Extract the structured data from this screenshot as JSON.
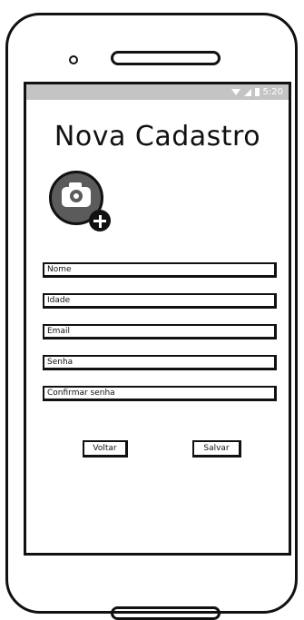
{
  "status_bar": {
    "time": "5:20"
  },
  "screen": {
    "title": "Nova Cadastro"
  },
  "form": {
    "fields": [
      {
        "placeholder": "Nome"
      },
      {
        "placeholder": "Idade"
      },
      {
        "placeholder": "Email"
      },
      {
        "placeholder": "Senha"
      },
      {
        "placeholder": "Confirmar senha"
      }
    ]
  },
  "buttons": {
    "back": "Voltar",
    "save": "Salvar"
  },
  "icons": {
    "photo": "add-photo-camera-icon"
  },
  "colors": {
    "status_bar": "#c4c4c4",
    "icon_fill": "#5b5b5b"
  }
}
